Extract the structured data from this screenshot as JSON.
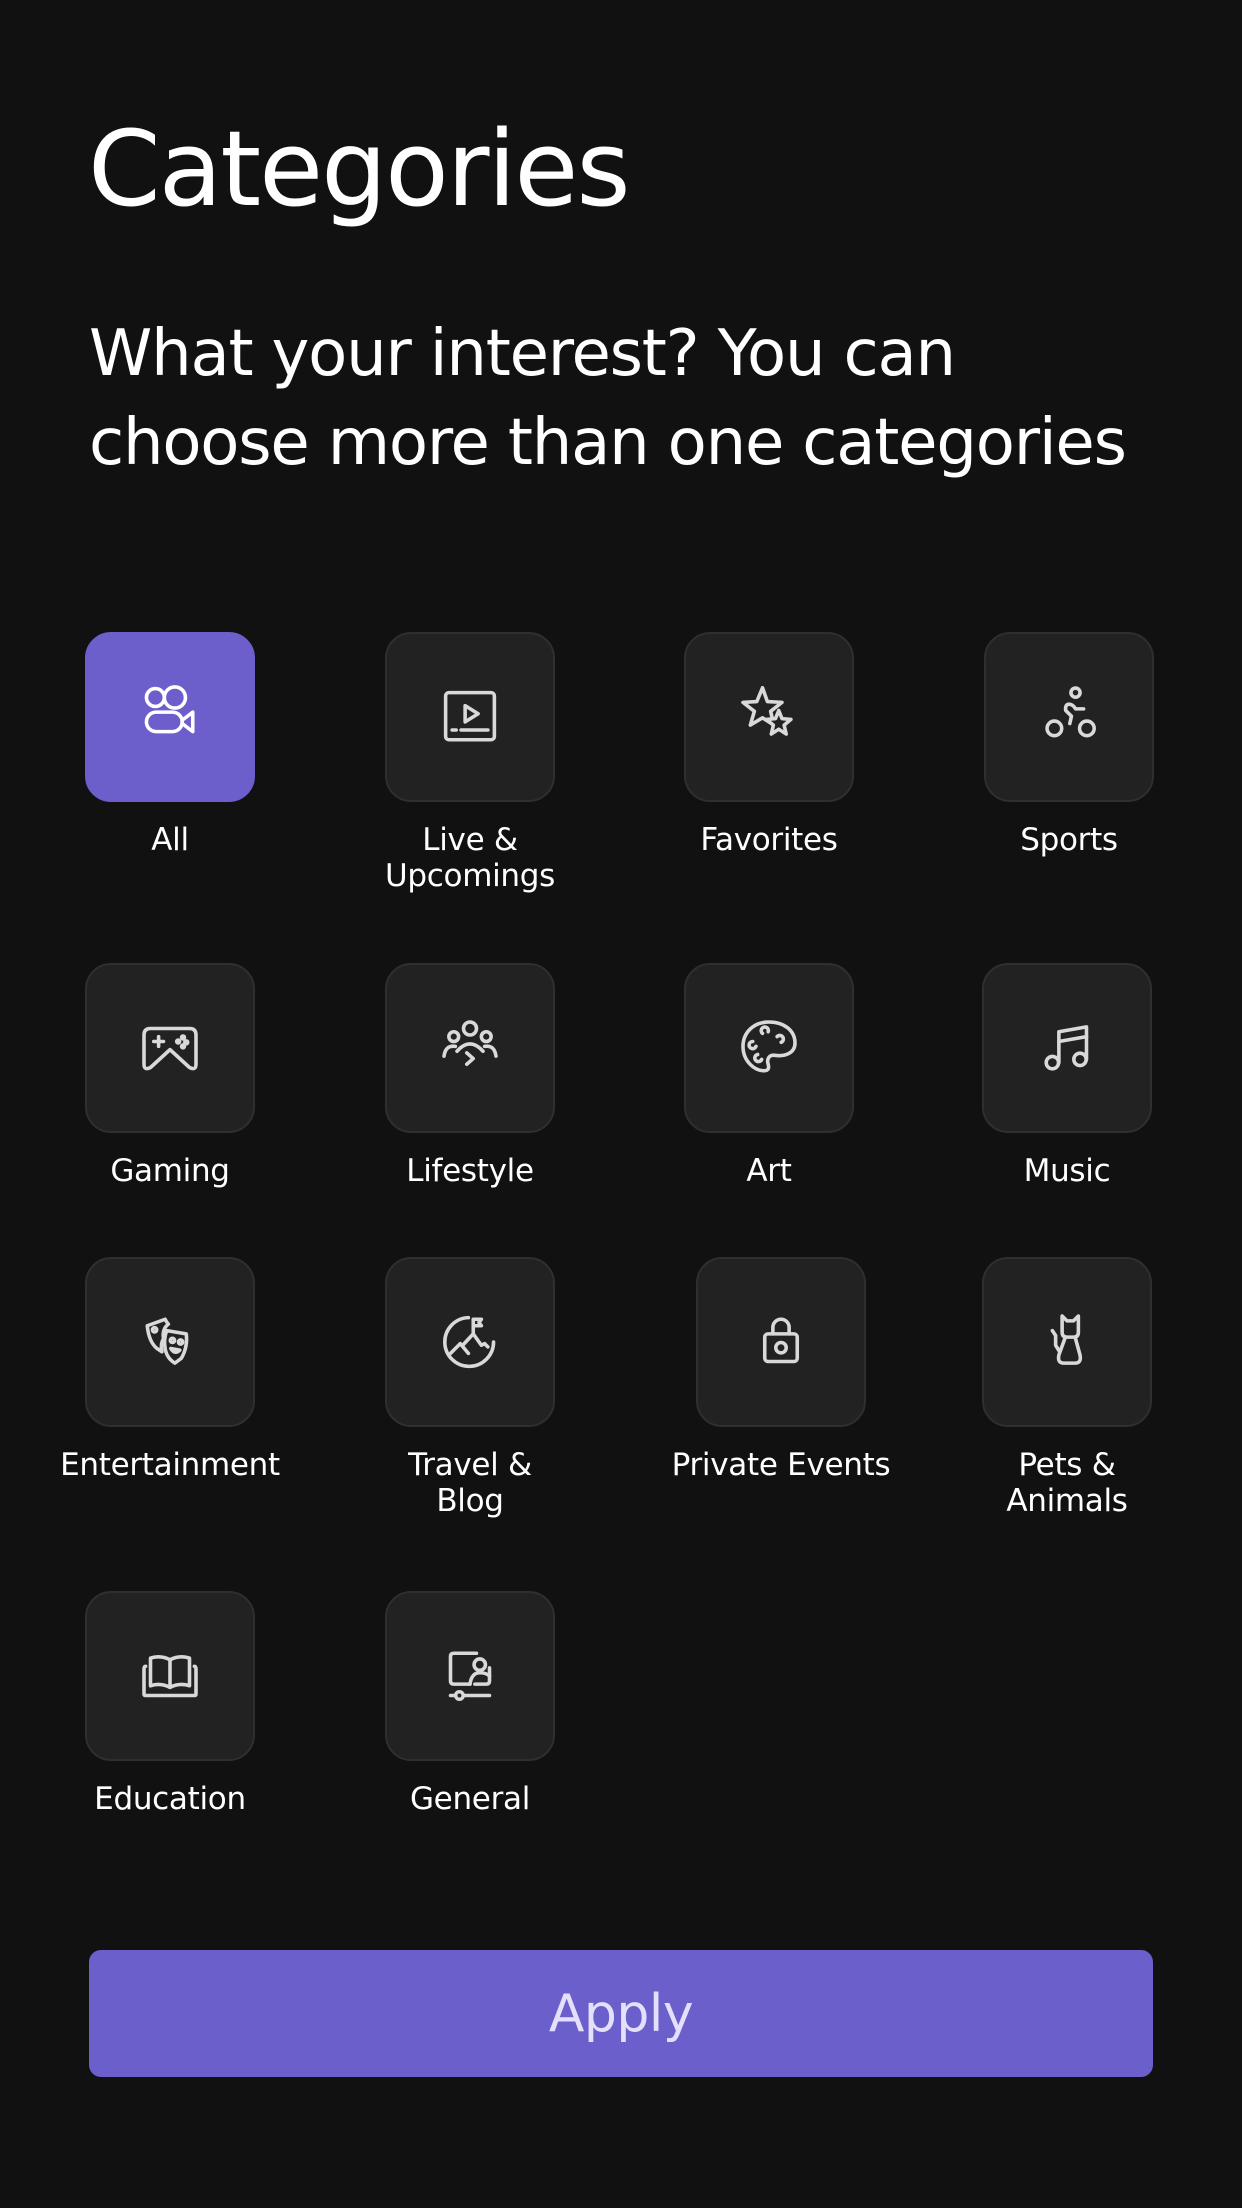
{
  "header": {
    "title": "Categories",
    "subtitle_line1": "What your interest? You can",
    "subtitle_line2": "choose more than one categories"
  },
  "categories": [
    {
      "label": "All",
      "icon": "video-camera-icon",
      "selected": true
    },
    {
      "label": "Live &\nUpcomings",
      "icon": "play-screen-icon",
      "selected": false
    },
    {
      "label": "Favorites",
      "icon": "stars-icon",
      "selected": false
    },
    {
      "label": "Sports",
      "icon": "cyclist-icon",
      "selected": false
    },
    {
      "label": "Gaming",
      "icon": "gamepad-icon",
      "selected": false
    },
    {
      "label": "Lifestyle",
      "icon": "people-group-icon",
      "selected": false
    },
    {
      "label": "Art",
      "icon": "palette-icon",
      "selected": false
    },
    {
      "label": "Music",
      "icon": "music-note-icon",
      "selected": false
    },
    {
      "label": "Entertainment",
      "icon": "theater-masks-icon",
      "selected": false
    },
    {
      "label": "Travel &\nBlog",
      "icon": "mountain-flag-icon",
      "selected": false
    },
    {
      "label": "Private Events",
      "icon": "lock-icon",
      "selected": false
    },
    {
      "label": "Pets &\nAnimals",
      "icon": "cat-icon",
      "selected": false
    },
    {
      "label": "Education",
      "icon": "open-book-icon",
      "selected": false
    },
    {
      "label": "General",
      "icon": "presenter-screen-icon",
      "selected": false
    }
  ],
  "apply_button": {
    "label": "Apply"
  },
  "colors": {
    "background": "#111111",
    "tile": "#222222",
    "accent": "#6c5fcb",
    "apply_text": "#e4e0fb"
  }
}
